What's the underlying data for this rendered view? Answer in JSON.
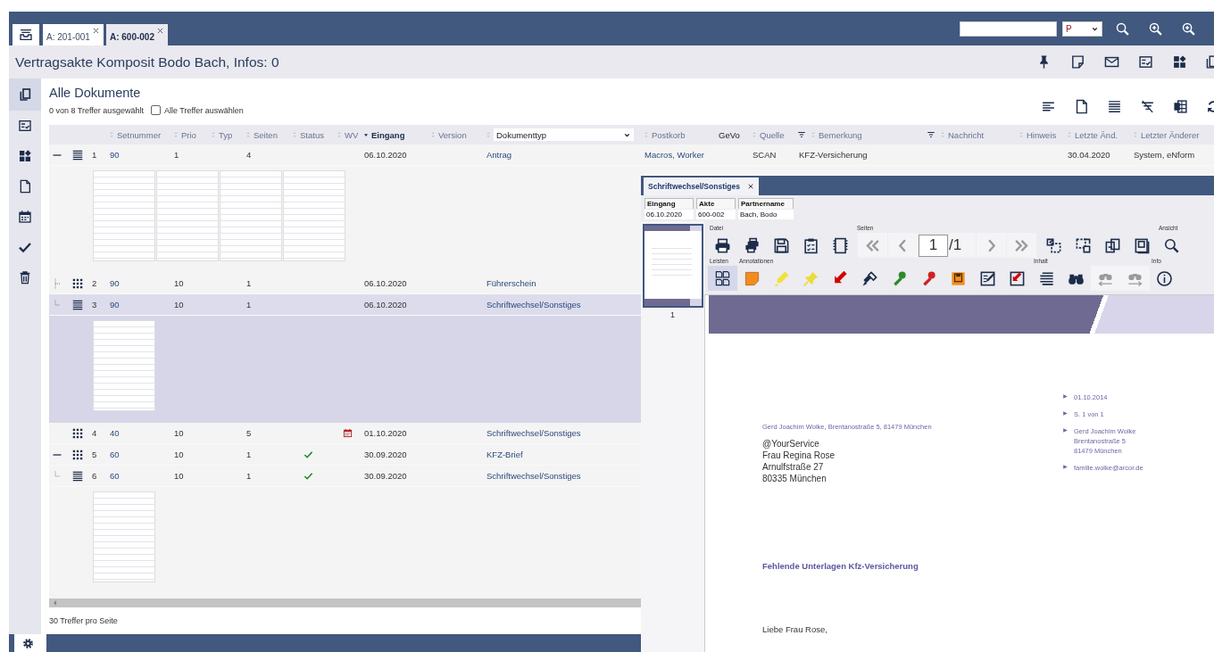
{
  "top_bar": {
    "tabs": [
      {
        "label": "A: 201-001",
        "selected": false
      },
      {
        "label": "A: 600-002",
        "selected": true
      }
    ],
    "search_mode": "P"
  },
  "header": {
    "title": "Vertragsakte Komposit Bodo Bach, Infos: 0"
  },
  "sidebar": {
    "items": [
      {
        "selected": true
      },
      {
        "selected": false
      },
      {
        "selected": false
      },
      {
        "selected": false
      },
      {
        "selected": false
      },
      {
        "selected": false
      },
      {
        "selected": false
      }
    ]
  },
  "list": {
    "title": "Alle Dokumente",
    "selection_info": "0 von 8 Treffer ausgewählt",
    "select_all": {
      "label": "Alle Treffer auswählen",
      "checked": false
    },
    "columns": [
      {
        "label": "Setnummer",
        "kind": "sort",
        "sorted": false,
        "filter": false
      },
      {
        "label": "Prio",
        "kind": "sort",
        "sorted": false,
        "filter": false
      },
      {
        "label": "Typ",
        "kind": "sort",
        "sorted": false,
        "filter": false
      },
      {
        "label": "Seiten",
        "kind": "sort",
        "sorted": false,
        "filter": false
      },
      {
        "label": "Status",
        "kind": "sort",
        "sorted": false,
        "filter": false
      },
      {
        "label": "WV",
        "kind": "sort",
        "sorted": false,
        "filter": false
      },
      {
        "label": "Eingang",
        "kind": "sort",
        "sorted": true,
        "filter": false
      },
      {
        "label": "Version",
        "kind": "sort",
        "sorted": false,
        "filter": false
      },
      {
        "label": "Dokumenttyp",
        "kind": "select",
        "sorted": false,
        "filter": false
      },
      {
        "label": "Postkorb",
        "kind": "sort",
        "sorted": false,
        "filter": false
      },
      {
        "label": "GeVo",
        "kind": "plain",
        "filter": false
      },
      {
        "label": "Quelle",
        "kind": "sort",
        "sorted": false,
        "filter": false
      },
      {
        "label": "Bemerkung",
        "kind": "sort",
        "sorted": false,
        "filter": true
      },
      {
        "label": "Nachricht",
        "kind": "sort",
        "sorted": false,
        "filter": true
      },
      {
        "label": "Hinweis",
        "kind": "sort",
        "sorted": false,
        "filter": false
      },
      {
        "label": "Letzte Änd.",
        "kind": "sort",
        "sorted": false,
        "filter": false
      },
      {
        "label": "Letzter Änderer",
        "kind": "sort",
        "sorted": false,
        "filter": false
      }
    ],
    "rows": [
      {
        "expanded": true,
        "kind": "stack",
        "number": "1",
        "setnummer": "90",
        "prio": "1",
        "seiten": "4",
        "status_done": false,
        "wv_due": false,
        "eingang": "06.10.2020",
        "dokumenttyp": "Antrag",
        "postkorb": "Macros, Worker",
        "quelle": "SCAN",
        "bemerkung": "KFZ-Versicherung",
        "letzte_aenderung": "30.04.2020",
        "letzter_aenderer": "System, eNform",
        "selected": false,
        "preview_open": true,
        "children": [
          {
            "kind": "set",
            "number": "2",
            "setnummer": "90",
            "prio": "10",
            "seiten": "1",
            "status_done": false,
            "wv_due": false,
            "eingang": "06.10.2020",
            "dokumenttyp": "Führerschein",
            "selected": false,
            "preview_open": false
          },
          {
            "kind": "stack",
            "number": "3",
            "setnummer": "90",
            "prio": "10",
            "seiten": "1",
            "status_done": false,
            "wv_due": false,
            "eingang": "06.10.2020",
            "dokumenttyp": "Schriftwechsel/Sonstiges",
            "selected": true,
            "preview_open": true
          }
        ]
      },
      {
        "kind": "set",
        "number": "4",
        "setnummer": "40",
        "prio": "10",
        "seiten": "5",
        "status_done": false,
        "wv_due": true,
        "eingang": "01.10.2020",
        "dokumenttyp": "Schriftwechsel/Sonstiges",
        "selected": false,
        "preview_open": false
      },
      {
        "expanded": true,
        "kind": "set",
        "number": "5",
        "setnummer": "60",
        "prio": "10",
        "seiten": "1",
        "status_done": true,
        "wv_due": false,
        "eingang": "30.09.2020",
        "dokumenttyp": "KFZ-Brief",
        "selected": false,
        "preview_open": false,
        "children": [
          {
            "kind": "stack",
            "number": "6",
            "setnummer": "60",
            "prio": "10",
            "seiten": "1",
            "status_done": true,
            "wv_due": false,
            "eingang": "30.09.2020",
            "dokumenttyp": "Schriftwechsel/Sonstiges",
            "selected": false,
            "preview_open": true
          }
        ]
      }
    ],
    "footer": "30 Treffer pro Seite"
  },
  "viewer": {
    "tab": {
      "label": "Schriftwechsel/Sonstiges",
      "selected": true
    },
    "meta": {
      "columns": [
        "Eingang",
        "Akte",
        "Partnername"
      ],
      "values": [
        "06.10.2020",
        "600-002",
        "Bach, Bodo"
      ]
    },
    "pages": [
      {
        "label": "1",
        "selected": true
      }
    ],
    "toolbar": [
      [
        {
          "kind": "file",
          "label": "Datei"
        },
        {
          "kind": "pages",
          "label": "Seiten",
          "page": "1",
          "total": "/1",
          "nav_disabled": true
        },
        {
          "kind": "page_tools"
        },
        {
          "kind": "view",
          "label": "Ansicht"
        }
      ],
      [
        {
          "kind": "panels",
          "label": "Leisten",
          "selected": true
        },
        {
          "kind": "annotations",
          "label": "Annotationen"
        },
        {
          "kind": "content",
          "label": "Inhalt",
          "search_nav_disabled": true
        },
        {
          "kind": "info",
          "label": "Info"
        }
      ]
    ],
    "document": {
      "sender_line": "Gerd Joachim Wolke, Brentanostraße 5, 81479 München",
      "recipient": [
        "@YourService",
        "Frau Regina Rose",
        "Arnulfstraße 27",
        "80335 München"
      ],
      "info": [
        {
          "lines": [
            "01.10.2014"
          ]
        },
        {
          "lines": [
            "S. 1 von 1"
          ]
        },
        {
          "lines": [
            "Gerd Joachim Wolke",
            "Brentanostraße 5",
            "81479 München"
          ]
        },
        {
          "lines": [
            "familie.wolke@arcor.de"
          ]
        }
      ],
      "subject": "Fehlende Unterlagen Kfz-Versicherung",
      "greeting": "Liebe Frau Rose,"
    }
  }
}
